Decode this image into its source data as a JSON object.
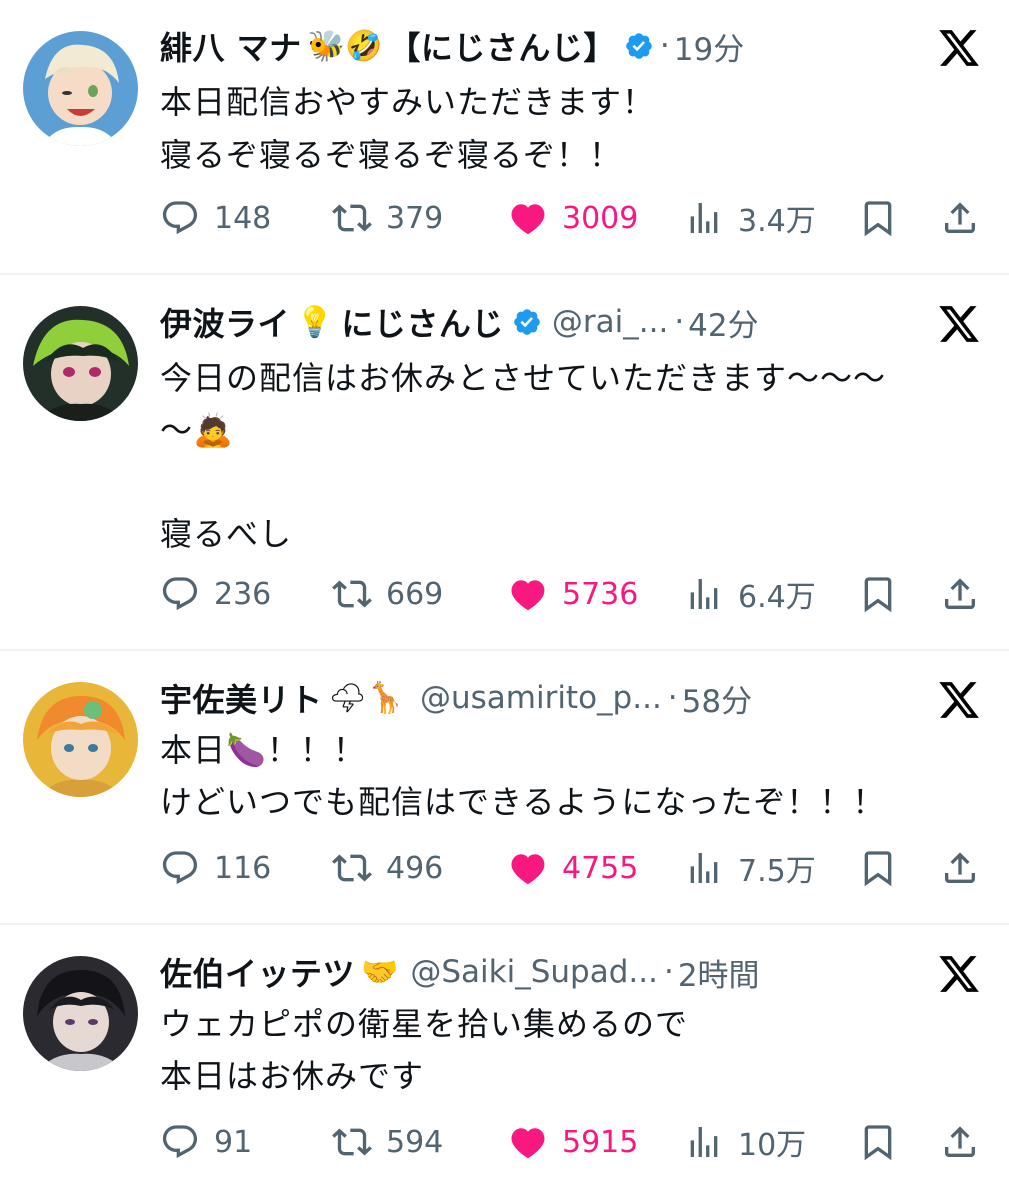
{
  "tweets": [
    {
      "name": "緋八 マナ",
      "emojis": "🐝🤣",
      "affiliation": "【にじさんじ】",
      "handle": "",
      "separator": "·",
      "time": "19分",
      "lines": [
        "本日配信おやすみいただきます！",
        "寝るぞ寝るぞ寝るぞ寝るぞ！！"
      ],
      "replies": "148",
      "retweets": "379",
      "likes": "3009",
      "views": "3.4万",
      "avatar_color": "#5b9fd4"
    },
    {
      "name": "伊波ライ",
      "emojis": "💡",
      "affiliation": "にじさんじ",
      "handle": "@rai_...",
      "separator": "·",
      "time": "42分",
      "lines": [
        "今日の配信はお休みとさせていただきます〜〜〜",
        "〜🙇",
        "",
        "寝るべし"
      ],
      "replies": "236",
      "retweets": "669",
      "likes": "5736",
      "views": "6.4万",
      "avatar_color": "#2b3a2e"
    },
    {
      "name": "宇佐美リト",
      "emojis": "🌩🦒",
      "affiliation": "",
      "handle": "@usamirito_p...",
      "separator": "·",
      "time": "58分",
      "lines": [
        "本日🍆！！！",
        "けどいつでも配信はできるようになったぞ！！！"
      ],
      "replies": "116",
      "retweets": "496",
      "likes": "4755",
      "views": "7.5万",
      "avatar_color": "#e8b73a"
    },
    {
      "name": "佐伯イッテツ",
      "emojis": "🤝",
      "affiliation": "",
      "handle": "@Saiki_Supad...",
      "separator": "·",
      "time": "2時間",
      "lines": [
        "ウェカピポの衛星を拾い集めるので",
        "本日はお休みです"
      ],
      "replies": "91",
      "retweets": "594",
      "likes": "5915",
      "views": "10万",
      "avatar_color": "#2a2a30"
    }
  ],
  "icons": {
    "reply": "reply-icon",
    "retweet": "retweet-icon",
    "like": "heart-icon",
    "views": "views-icon",
    "bookmark": "bookmark-icon",
    "share": "share-icon",
    "x": "x-logo-icon",
    "verified": "verified-badge-icon"
  },
  "colors": {
    "like": "#f91880",
    "muted": "#536471",
    "verified": "#1d9bf0",
    "text": "#0f1419",
    "divider": "#eff3f4"
  }
}
